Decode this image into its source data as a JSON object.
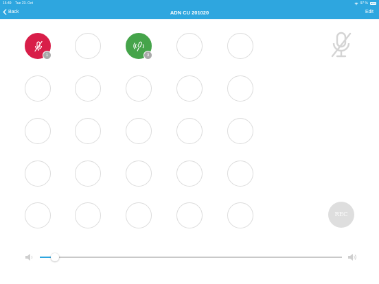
{
  "status_bar": {
    "time": "16:49",
    "date": "Tue 23. Oct",
    "battery": "97 %"
  },
  "nav": {
    "back_label": "Back",
    "title": "ADN CU 201020",
    "edit_label": "Edit"
  },
  "seats": [
    {
      "state": "muted",
      "badge": "1"
    },
    {
      "state": "empty"
    },
    {
      "state": "speaking",
      "badge": "3"
    },
    {
      "state": "empty"
    },
    {
      "state": "empty"
    },
    {
      "state": "empty"
    },
    {
      "state": "empty"
    },
    {
      "state": "empty"
    },
    {
      "state": "empty"
    },
    {
      "state": "empty"
    },
    {
      "state": "empty"
    },
    {
      "state": "empty"
    },
    {
      "state": "empty"
    },
    {
      "state": "empty"
    },
    {
      "state": "empty"
    },
    {
      "state": "empty"
    },
    {
      "state": "empty"
    },
    {
      "state": "empty"
    },
    {
      "state": "empty"
    },
    {
      "state": "empty"
    },
    {
      "state": "empty"
    },
    {
      "state": "empty"
    },
    {
      "state": "empty"
    },
    {
      "state": "empty"
    },
    {
      "state": "empty"
    }
  ],
  "rec_button": {
    "label": "REC"
  },
  "volume": {
    "level": 0.05
  },
  "colors": {
    "accent": "#2ea6df",
    "muted": "#d81e49",
    "speaking": "#45a44a",
    "badge": "#a9a9a9",
    "outline": "#dcdcdc"
  },
  "icons": {
    "mute": "microphone-muted-icon",
    "speak": "microphone-speaking-icon",
    "back": "chevron-left-icon",
    "volume_low": "speaker-low-icon",
    "volume_high": "speaker-high-icon"
  }
}
